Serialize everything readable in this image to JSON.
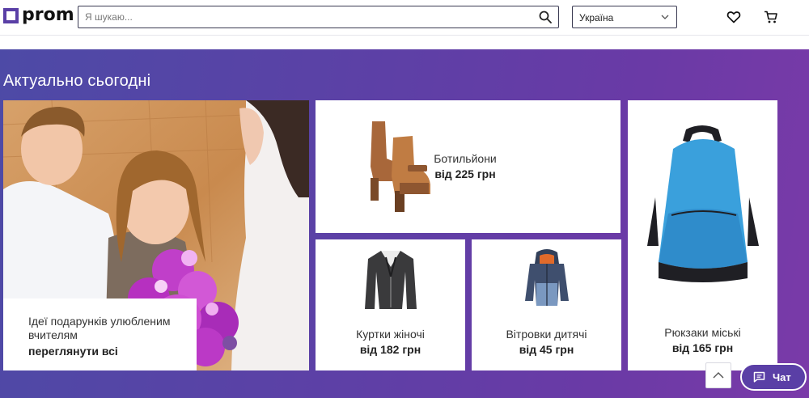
{
  "header": {
    "logo_text": "prom",
    "search_placeholder": "Я шукаю...",
    "search_icon": "search-icon",
    "region": "Україна",
    "icons": [
      "heart-icon",
      "cart-icon"
    ]
  },
  "promo": {
    "title": "Актуально сьогодні",
    "hero": {
      "caption_line": "Ідеї подарунків улюбленим вчителям",
      "caption_link": "переглянути всі"
    },
    "cards": [
      {
        "label": "Ботильйони",
        "price": "від 225 грн"
      },
      {
        "label": "Куртки жіночі",
        "price": "від 182 грн"
      },
      {
        "label": "Вітровки дитячі",
        "price": "від 45 грн"
      },
      {
        "label": "Рюкзаки міські",
        "price": "від 165 грн"
      }
    ]
  },
  "chat": {
    "label": "Чат"
  },
  "colors": {
    "brand": "#5a3fa6",
    "banner_start": "#4d4aa6",
    "banner_end": "#7a3aa8"
  }
}
